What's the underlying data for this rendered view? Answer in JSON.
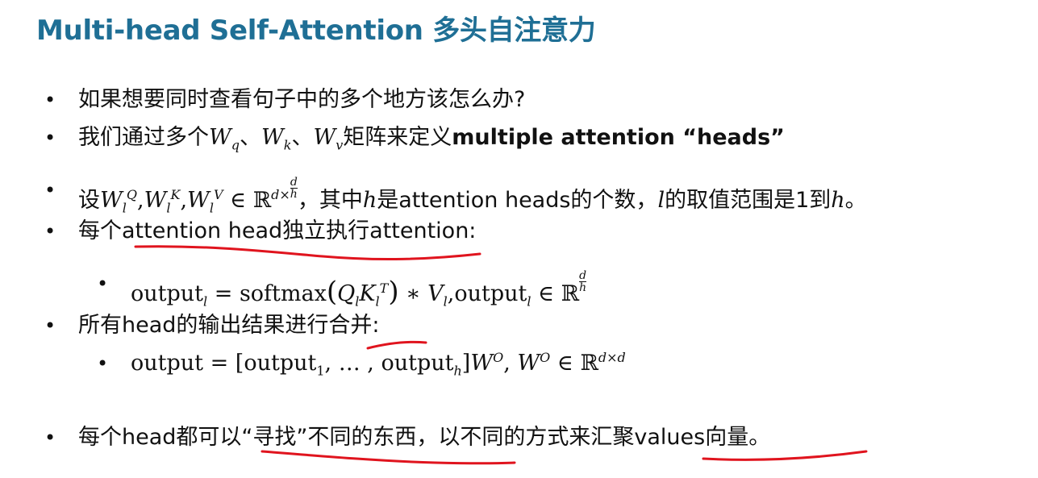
{
  "title": "Multi-head Self-Attention 多头自注意力",
  "bullets": {
    "b1": "如果想要同时查看句子中的多个地方该怎么办?",
    "b2": {
      "pre": "我们通过多个",
      "wq": "W",
      "q": "q",
      "sep1": "、",
      "wk": "W",
      "k": "k",
      "sep2": "、",
      "wv": "W",
      "v": "v",
      "mid": "矩阵来定义",
      "bold": "multiple attention “heads”"
    },
    "b3": {
      "pre": "设",
      "w": "W",
      "l": "l",
      "supQ": "Q",
      "supK": "K",
      "supV": "V",
      "comma": ",",
      "in": "∈",
      "R": "ℝ",
      "dx": "d×",
      "fd": "d",
      "fh": "h",
      "mid1": "，其中",
      "h": "h",
      "mid2": "是attention heads的个数，",
      "lv": "l",
      "mid3": "的取值范围是1到",
      "end": "。"
    },
    "b4": "每个attention head独立执行attention:",
    "b5": {
      "out": "output",
      "l": "l",
      "eq": " = softmax",
      "lp": "(",
      "Q": "Q",
      "K": "K",
      "T": "T",
      "rp": ")",
      "star": " ∗ ",
      "V": "V",
      "comma": ",",
      "in": " ∈ ",
      "R": "ℝ",
      "fd": "d",
      "fh": "h"
    },
    "b6": "所有head的输出结果进行合并:",
    "b7": {
      "pre": "output = [output",
      "one": "1",
      "dots": ", … , output",
      "h": "h",
      "rb": "]",
      "W": "W",
      "O": "O",
      "comma": ", ",
      "in": " ∈ ",
      "R": "ℝ",
      "dxd": "d×d"
    },
    "b8": "每个head都可以“寻找”不同的东西，以不同的方式来汇聚values向量。"
  },
  "colors": {
    "title": "#1f6f95",
    "annotation": "#e0141e"
  }
}
